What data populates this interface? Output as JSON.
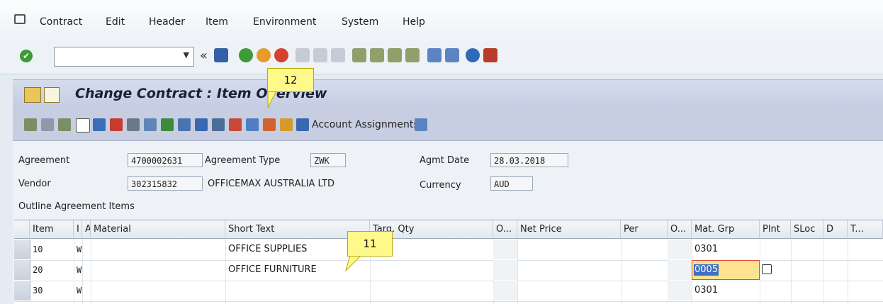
{
  "menu": {
    "items": [
      "Contract",
      "Edit",
      "Header",
      "Item",
      "Environment",
      "System",
      "Help"
    ]
  },
  "toolbar": {
    "command_field_value": "",
    "back_label": "«"
  },
  "title": "Change Contract : Item Overview",
  "app_toolbar": {
    "account_assignments_label": "Account Assignments"
  },
  "header_fields": {
    "agreement_label": "Agreement",
    "agreement_value": "4700002631",
    "agreement_type_label": "Agreement Type",
    "agreement_type_value": "ZWK",
    "agmt_date_label": "Agmt Date",
    "agmt_date_value": "28.03.2018",
    "vendor_label": "Vendor",
    "vendor_value": "302315832",
    "vendor_name": "OFFICEMAX AUSTRALIA LTD",
    "currency_label": "Currency",
    "currency_value": "AUD"
  },
  "section_title": "Outline Agreement Items",
  "table": {
    "columns": [
      "Item",
      "I",
      "A",
      "Material",
      "Short Text",
      "Targ. Qty",
      "O...",
      "Net Price",
      "Per",
      "O...",
      "Mat. Grp",
      "Plnt",
      "SLoc",
      "D",
      "T..."
    ],
    "rows": [
      {
        "item": "10",
        "i": "W",
        "short_text": "OFFICE SUPPLIES",
        "mat_grp": "0301"
      },
      {
        "item": "20",
        "i": "W",
        "short_text": "OFFICE FURNITURE",
        "mat_grp": "0005"
      },
      {
        "item": "30",
        "i": "W",
        "short_text": "",
        "mat_grp": "0301"
      }
    ]
  },
  "callouts": {
    "step_12": "12",
    "step_11": "11"
  },
  "colors": {
    "title_bar": "#c3cbe1",
    "callout": "#fff98a",
    "selected_cell": "#fde28f"
  }
}
